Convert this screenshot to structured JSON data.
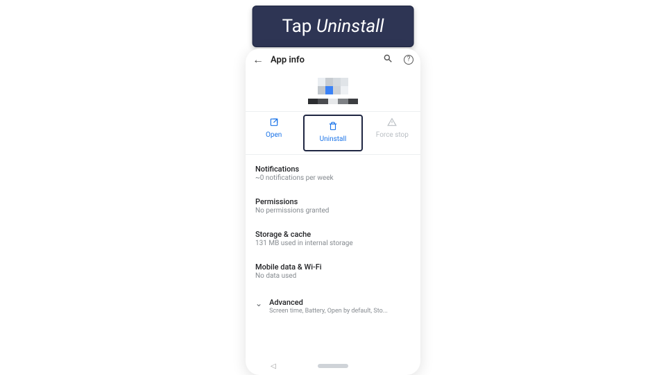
{
  "instruction": {
    "prefix": "Tap ",
    "action": "Uninstall"
  },
  "appbar": {
    "title": "App info"
  },
  "actions": {
    "open": "Open",
    "uninstall": "Uninstall",
    "force_stop": "Force stop"
  },
  "settings": {
    "notifications": {
      "title": "Notifications",
      "sub": "~0 notifications per week"
    },
    "permissions": {
      "title": "Permissions",
      "sub": "No permissions granted"
    },
    "storage": {
      "title": "Storage & cache",
      "sub": "131 MB used in internal storage"
    },
    "data": {
      "title": "Mobile data & Wi-Fi",
      "sub": "No data used"
    },
    "advanced": {
      "title": "Advanced",
      "sub": "Screen time, Battery, Open by default, Sto..."
    }
  }
}
